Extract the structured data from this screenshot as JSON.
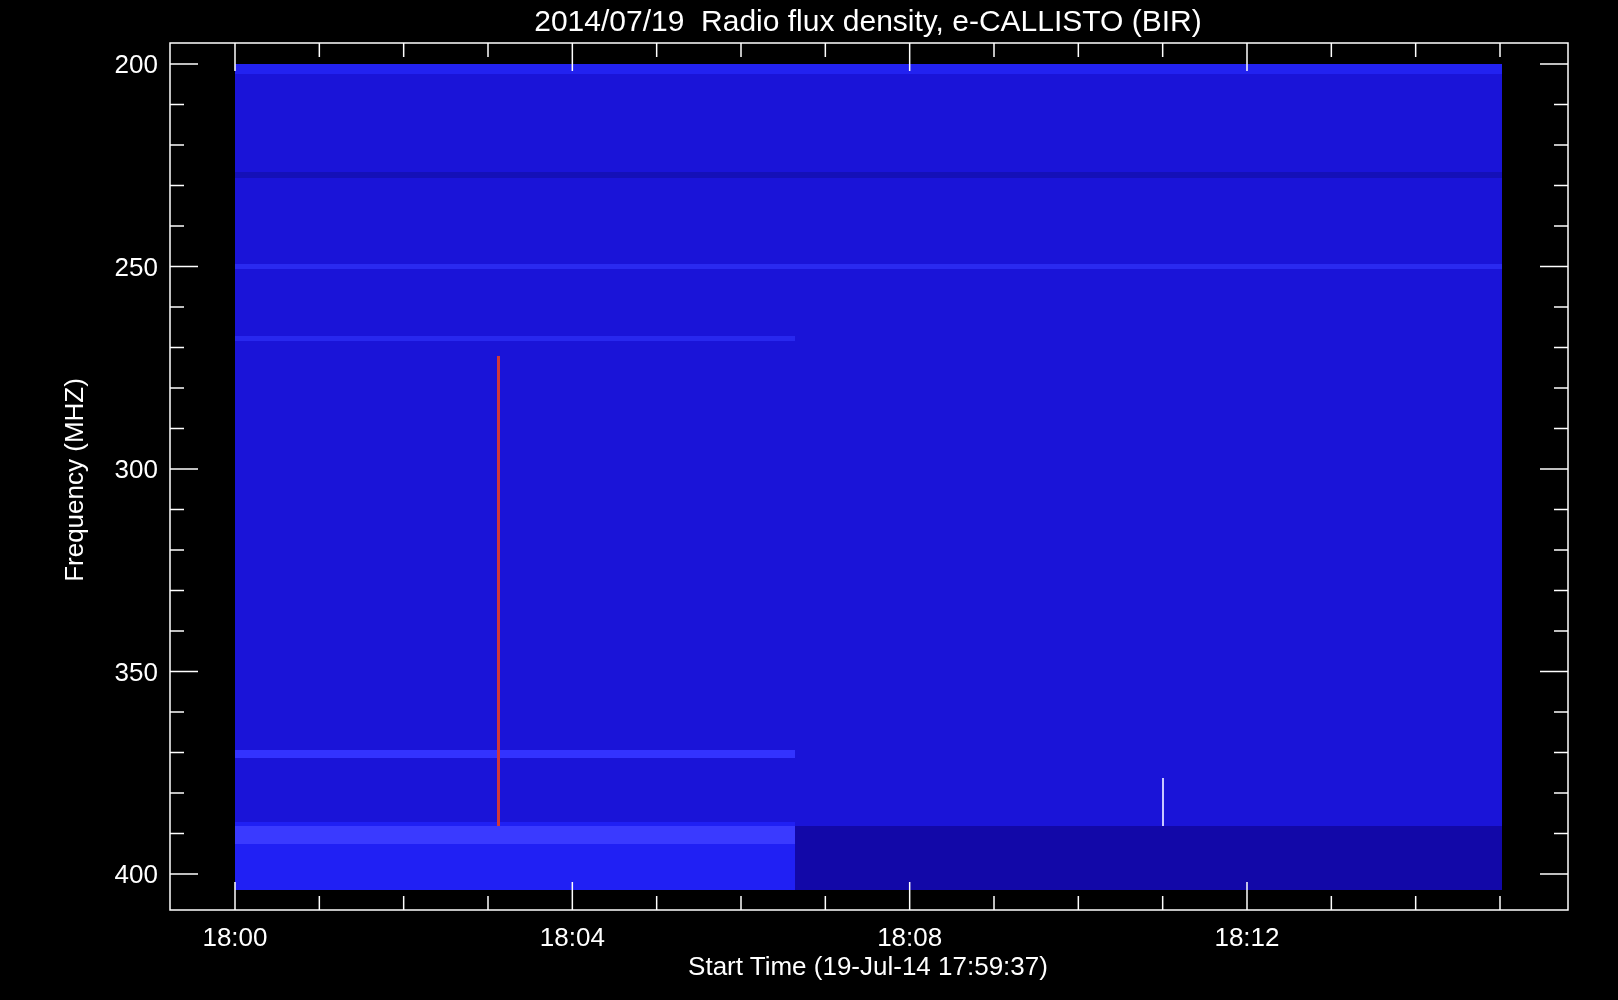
{
  "plot": {
    "title": "2014/07/19  Radio flux density, e-CALLISTO (BIR)",
    "ylabel": "Frequency (MHZ)",
    "xlabel": "Start Time (19-Jul-14 17:59:37)",
    "yticks": [
      "200",
      "250",
      "300",
      "350",
      "400"
    ],
    "xticks": [
      "18:00",
      "18:04",
      "18:08",
      "18:12"
    ]
  }
}
